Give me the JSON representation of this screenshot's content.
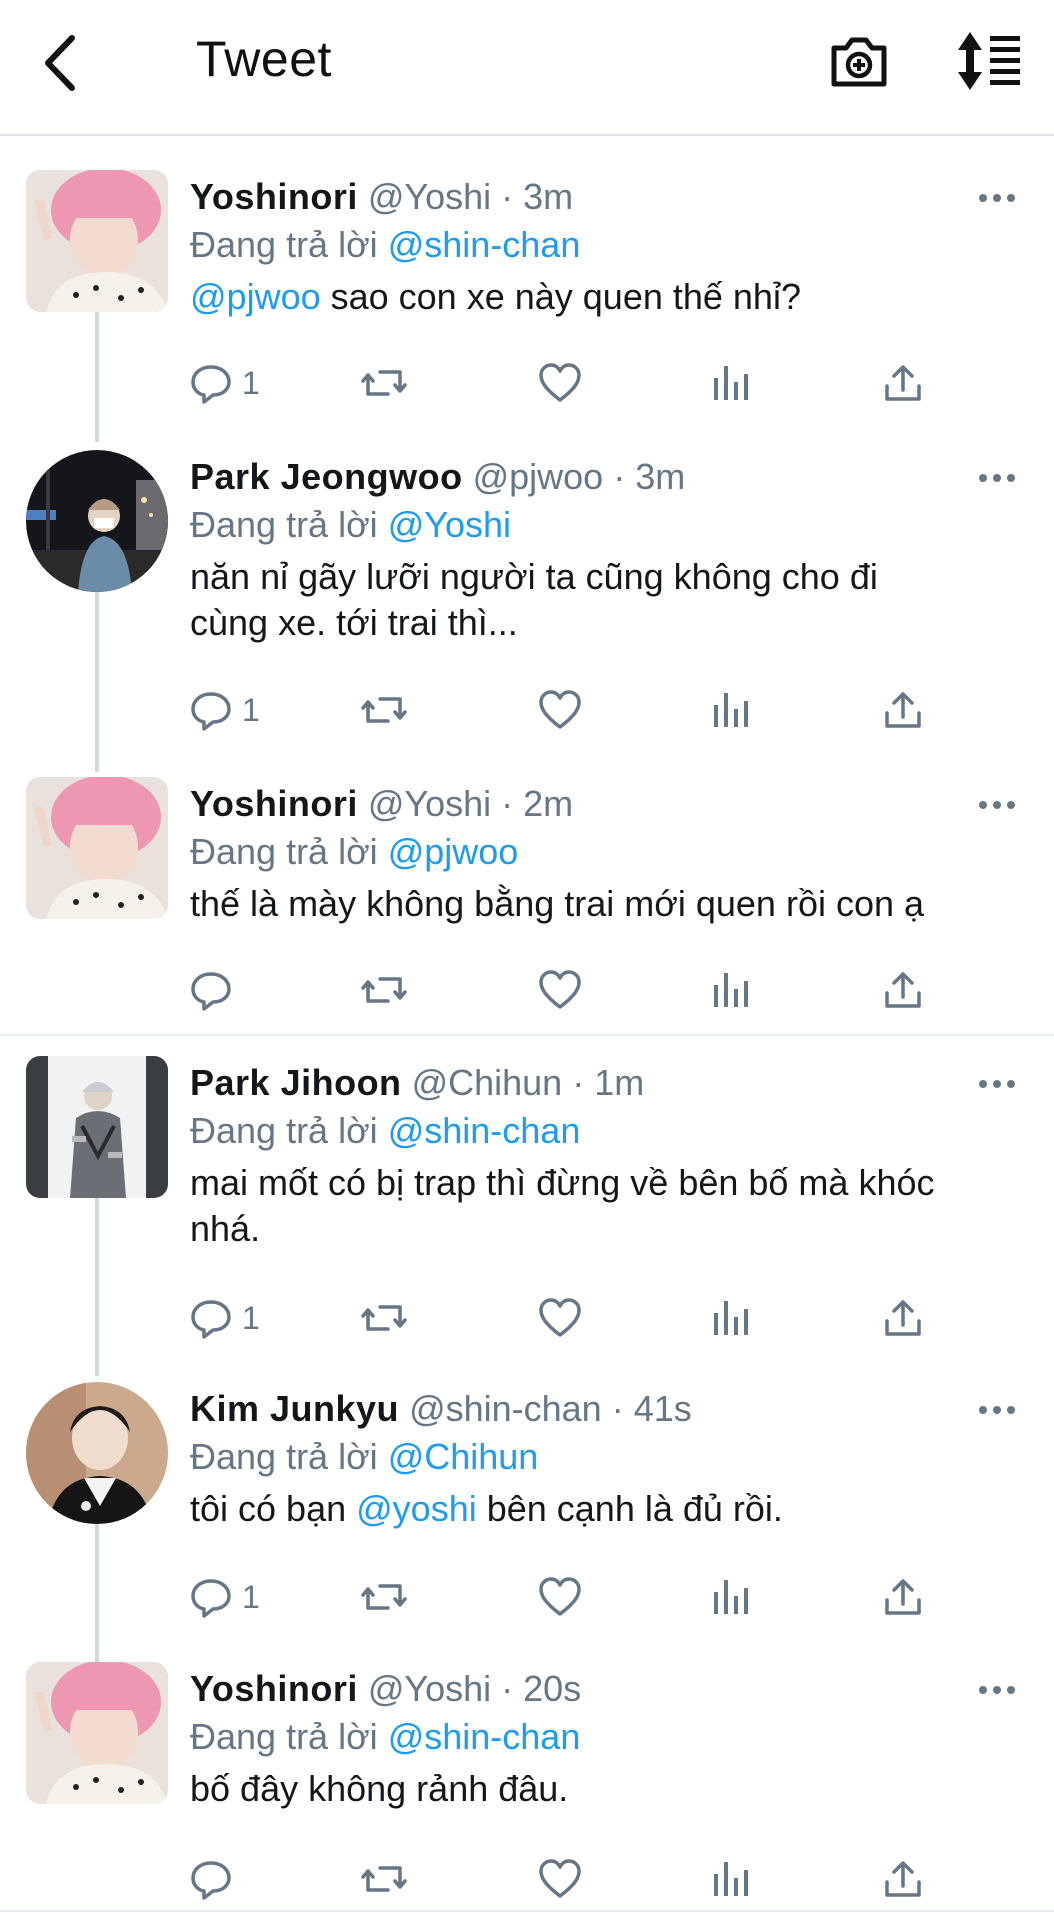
{
  "header": {
    "title": "Tweet",
    "icons": [
      "back-arrow-icon",
      "camera-icon",
      "sort-icon"
    ]
  },
  "tweets": [
    {
      "name": "Yoshinori",
      "handle": "@Yoshi",
      "time": "· 3m",
      "reply_prefix": "Đang trả lời",
      "reply_to": "@shin-chan",
      "mention": "@pjwoo",
      "text": " sao con xe này quen thế nhỉ?",
      "reply_count": "1",
      "avatar": "pink-hair"
    },
    {
      "name": "Park Jeongwoo",
      "handle": "@pjwoo",
      "time": "· 3m",
      "reply_prefix": "Đang trả lời",
      "reply_to": "@Yoshi",
      "text": "năn nỉ gãy lưỡi người ta cũng không cho đi cùng xe. tới trai thì...",
      "reply_count": "1",
      "avatar": "night-street"
    },
    {
      "name": "Yoshinori",
      "handle": "@Yoshi",
      "time": "· 2m",
      "reply_prefix": "Đang trả lời",
      "reply_to": "@pjwoo",
      "text": "thế là mày không bằng trai mới quen rồi con ạ",
      "reply_count": "",
      "avatar": "pink-hair"
    },
    {
      "name": "Park Jihoon",
      "handle": "@Chihun",
      "time": "· 1m",
      "reply_prefix": "Đang trả lời",
      "reply_to": "@shin-chan",
      "text": "mai mốt có bị trap thì đừng về bên bố mà khóc nhá.",
      "reply_count": "1",
      "avatar": "grey-hair"
    },
    {
      "name": "Kim Junkyu",
      "handle": "@shin-chan",
      "time": "· 41s",
      "reply_prefix": "Đang trả lời",
      "reply_to": "@Chihun",
      "text_before": "tôi có bạn ",
      "mention": "@yoshi",
      "text_after": " bên cạnh là đủ rồi.",
      "reply_count": "1",
      "avatar": "dark-jacket"
    },
    {
      "name": "Yoshinori",
      "handle": "@Yoshi",
      "time": "· 20s",
      "reply_prefix": "Đang trả lời",
      "reply_to": "@shin-chan",
      "text": "bố đây không rảnh đâu.",
      "reply_count": "",
      "avatar": "pink-hair"
    }
  ],
  "colors": {
    "link": "#1d9bf0",
    "muted": "#657786",
    "text": "#14171a"
  }
}
